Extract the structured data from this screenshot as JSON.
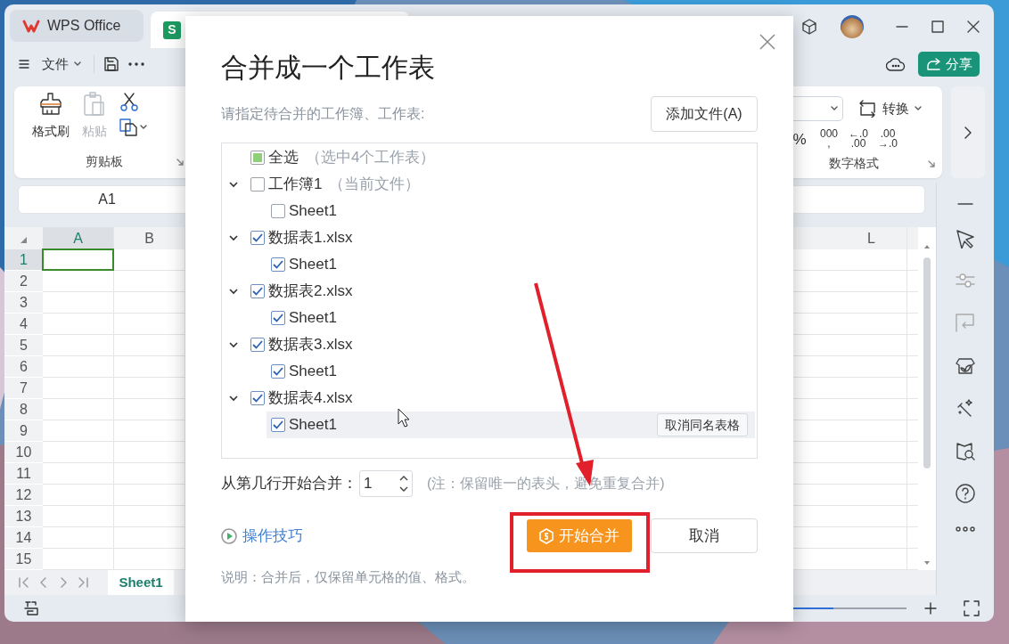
{
  "window": {
    "tabs": [
      {
        "kind": "home",
        "label": "WPS Office",
        "selected": false
      },
      {
        "kind": "document",
        "icon_letter": "S",
        "selected": true
      }
    ],
    "menu_label": "文件",
    "share_label": "分享"
  },
  "ribbon": {
    "clipboard": {
      "title": "剪贴板",
      "format_painter": "格式刷",
      "paste": {
        "label": "粘贴",
        "disabled": true
      }
    },
    "number_format": {
      "title": "数字格式",
      "convert_label": "转换",
      "buttons": [
        {
          "lines": [
            "%"
          ]
        },
        {
          "lines": [
            "000",
            ","
          ]
        },
        {
          "lines": [
            "←.0",
            ".00"
          ]
        },
        {
          "lines": [
            ".00",
            "→.0"
          ]
        }
      ]
    }
  },
  "name_box": "A1",
  "sheet": {
    "columns": [
      {
        "label": "A",
        "selected": true
      },
      {
        "label": "B",
        "selected": false
      },
      {
        "label": "L",
        "selected": false
      }
    ],
    "rows": [
      {
        "label": "1",
        "selected": true
      },
      {
        "label": "2",
        "selected": false
      },
      {
        "label": "3",
        "selected": false
      },
      {
        "label": "4",
        "selected": false
      },
      {
        "label": "5",
        "selected": false
      },
      {
        "label": "6",
        "selected": false
      },
      {
        "label": "7",
        "selected": false
      },
      {
        "label": "8",
        "selected": false
      },
      {
        "label": "9",
        "selected": false
      },
      {
        "label": "10",
        "selected": false
      },
      {
        "label": "11",
        "selected": false
      },
      {
        "label": "12",
        "selected": false
      },
      {
        "label": "13",
        "selected": false
      },
      {
        "label": "14",
        "selected": false
      },
      {
        "label": "15",
        "selected": false
      }
    ],
    "tabs": [
      {
        "label": "Sheet1",
        "selected": true
      }
    ]
  },
  "status_bar": {
    "zoom": {
      "level": 0.5
    }
  },
  "dialog": {
    "title": "合并成一个工作表",
    "instruction": "请指定待合并的工作簿、工作表:",
    "add_button": "添加文件(A)",
    "select_all": {
      "label": "全选",
      "note": "（选中4个工作表）",
      "indeterminate": true
    },
    "workbooks": [
      {
        "label": "工作簿1",
        "note": "（当前文件）",
        "checked": false,
        "expanded": true,
        "children": [
          {
            "label": "Sheet1",
            "checked": false,
            "hovered": false
          }
        ]
      },
      {
        "label": "数据表1.xlsx",
        "checked": true,
        "expanded": true,
        "children": [
          {
            "label": "Sheet1",
            "checked": true,
            "hovered": false
          }
        ]
      },
      {
        "label": "数据表2.xlsx",
        "checked": true,
        "expanded": true,
        "children": [
          {
            "label": "Sheet1",
            "checked": true,
            "hovered": false
          }
        ]
      },
      {
        "label": "数据表3.xlsx",
        "checked": true,
        "expanded": true,
        "children": [
          {
            "label": "Sheet1",
            "checked": true,
            "hovered": false
          }
        ]
      },
      {
        "label": "数据表4.xlsx",
        "checked": true,
        "expanded": true,
        "children": [
          {
            "label": "Sheet1",
            "checked": true,
            "hovered": true,
            "action": "取消同名表格"
          }
        ]
      }
    ],
    "start_row": {
      "label": "从第几行开始合并：",
      "value": "1",
      "note": "(注：保留唯一的表头，避免重复合并)"
    },
    "tips_link": "操作技巧",
    "start_button": "开始合并",
    "cancel_button": "取消",
    "description": "说明：合并后，仅保留单元格的值、格式。"
  }
}
